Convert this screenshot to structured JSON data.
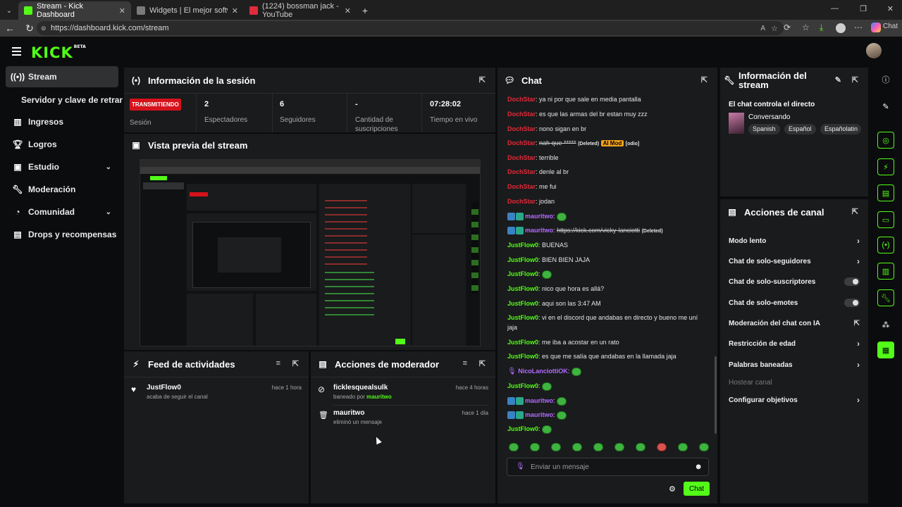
{
  "browser": {
    "tabs": [
      {
        "title": "Stream - Kick Dashboard",
        "fav_color": "#53fc18"
      },
      {
        "title": "Widgets | El mejor software para",
        "fav_color": "#7a7a7a"
      },
      {
        "title": "(1224) bossman jack - YouTube",
        "fav_color": "#e02b3b"
      }
    ],
    "url": "https://dashboard.kick.com/stream",
    "copilot_label": "Chat"
  },
  "app": {
    "logo": "KICK",
    "logo_sup": "BETA"
  },
  "sidebar": {
    "items": [
      {
        "label": "Stream",
        "icon": "broadcast-icon"
      },
      {
        "label": "Servidor y clave de retransmisión"
      },
      {
        "label": "Ingresos",
        "icon": "revenue-icon"
      },
      {
        "label": "Logros",
        "icon": "trophy-icon"
      },
      {
        "label": "Estudio",
        "icon": "studio-icon"
      },
      {
        "label": "Moderación",
        "icon": "wrench-icon"
      },
      {
        "label": "Comunidad",
        "icon": "community-icon"
      },
      {
        "label": "Drops y recompensas",
        "icon": "drops-icon"
      }
    ]
  },
  "session": {
    "title": "Información de la sesión",
    "live_badge": "TRANSMITIENDO",
    "session_label": "Sesión",
    "stats": [
      {
        "value": "2",
        "label": "Espectadores"
      },
      {
        "value": "6",
        "label": "Seguidores"
      },
      {
        "value": "-",
        "label": "Cantidad de suscripciones"
      },
      {
        "value": "07:28:02",
        "label": "Tiempo en vivo"
      }
    ]
  },
  "preview": {
    "title": "Vista previa del stream"
  },
  "feed": {
    "title": "Feed de actividades",
    "items": [
      {
        "user": "JustFlow0",
        "action": "acaba de seguir el canal",
        "time": "hace 1 hora"
      }
    ]
  },
  "modactions": {
    "title": "Acciones de moderador",
    "items": [
      {
        "user": "ficklesquealsulk",
        "action_prefix": "baneado por",
        "by": "mauritwo",
        "time": "hace 4 horas"
      },
      {
        "user": "mauritwo",
        "action_prefix": "eliminó un mensaje",
        "by": "",
        "time": "hace 1 día"
      }
    ]
  },
  "chat": {
    "title": "Chat",
    "messages": [
      {
        "user": "DochStar",
        "text": "ya ni por que sale en media pantalla"
      },
      {
        "user": "DochStar",
        "text": "es que las armas del br estan muy zzz"
      },
      {
        "user": "DochStar",
        "text": "nono sigan en br"
      },
      {
        "user": "DochStar",
        "text": "nah que *****",
        "deleted": "(Deleted)",
        "ai": "AI Mod",
        "extra": "[odio]"
      },
      {
        "user": "DochStar",
        "text": "terrible"
      },
      {
        "user": "DochStar",
        "text": "denle al br"
      },
      {
        "user": "DochStar",
        "text": "me fui"
      },
      {
        "user": "DochStar",
        "text": "jodan"
      },
      {
        "user": "mauritwo",
        "text": ""
      },
      {
        "user": "mauritwo",
        "text": "https://kick.com/vicky-lanciotti",
        "deleted": "(Deleted)"
      },
      {
        "user": "JustFlow0",
        "text": "BUENAS"
      },
      {
        "user": "JustFlow0",
        "text": "BIEN BIEN JAJA"
      },
      {
        "user": "JustFlow0",
        "text": ""
      },
      {
        "user": "JustFlow0",
        "text": "nico que hora es allá?"
      },
      {
        "user": "JustFlow0",
        "text": "aqui son las 3:47 AM"
      },
      {
        "user": "JustFlow0",
        "text": "vi en el discord que andabas en directo y bueno me uní jaja"
      },
      {
        "user": "JustFlow0",
        "text": "me iba a acostar en un rato"
      },
      {
        "user": "JustFlow0",
        "text": "es que me salía que andabas en la llamada jaja"
      },
      {
        "user": "NicoLanciottiOK",
        "text": ""
      },
      {
        "user": "JustFlow0",
        "text": ""
      },
      {
        "user": "mauritwo",
        "text": ""
      },
      {
        "user": "mauritwo",
        "text": ""
      },
      {
        "user": "JustFlow0",
        "text": ""
      }
    ],
    "input_placeholder": "Enviar un mensaje",
    "send_label": "Chat"
  },
  "streaminfo": {
    "title": "Información del stream",
    "subtitle": "El chat controla el directo",
    "category": "Conversando",
    "languages": [
      "Spanish",
      "Español",
      "Españolatin"
    ]
  },
  "channelactions": {
    "title": "Acciones de canal",
    "items": [
      {
        "label": "Modo lento",
        "control": "chevron"
      },
      {
        "label": "Chat de solo-seguidores",
        "control": "chevron"
      },
      {
        "label": "Chat de solo-suscriptores",
        "control": "toggle"
      },
      {
        "label": "Chat de solo-emotes",
        "control": "toggle"
      },
      {
        "label": "Moderación del chat con IA",
        "control": "external"
      },
      {
        "label": "Restricción de edad",
        "control": "chevron"
      },
      {
        "label": "Palabras baneadas",
        "control": "chevron"
      },
      {
        "label": "Hostear canal",
        "control": "none"
      },
      {
        "label": "Configurar objetivos",
        "control": "chevron"
      }
    ]
  },
  "colors": {
    "accent": "#53fc18",
    "live": "#d5121c",
    "panel": "#191b1c"
  }
}
